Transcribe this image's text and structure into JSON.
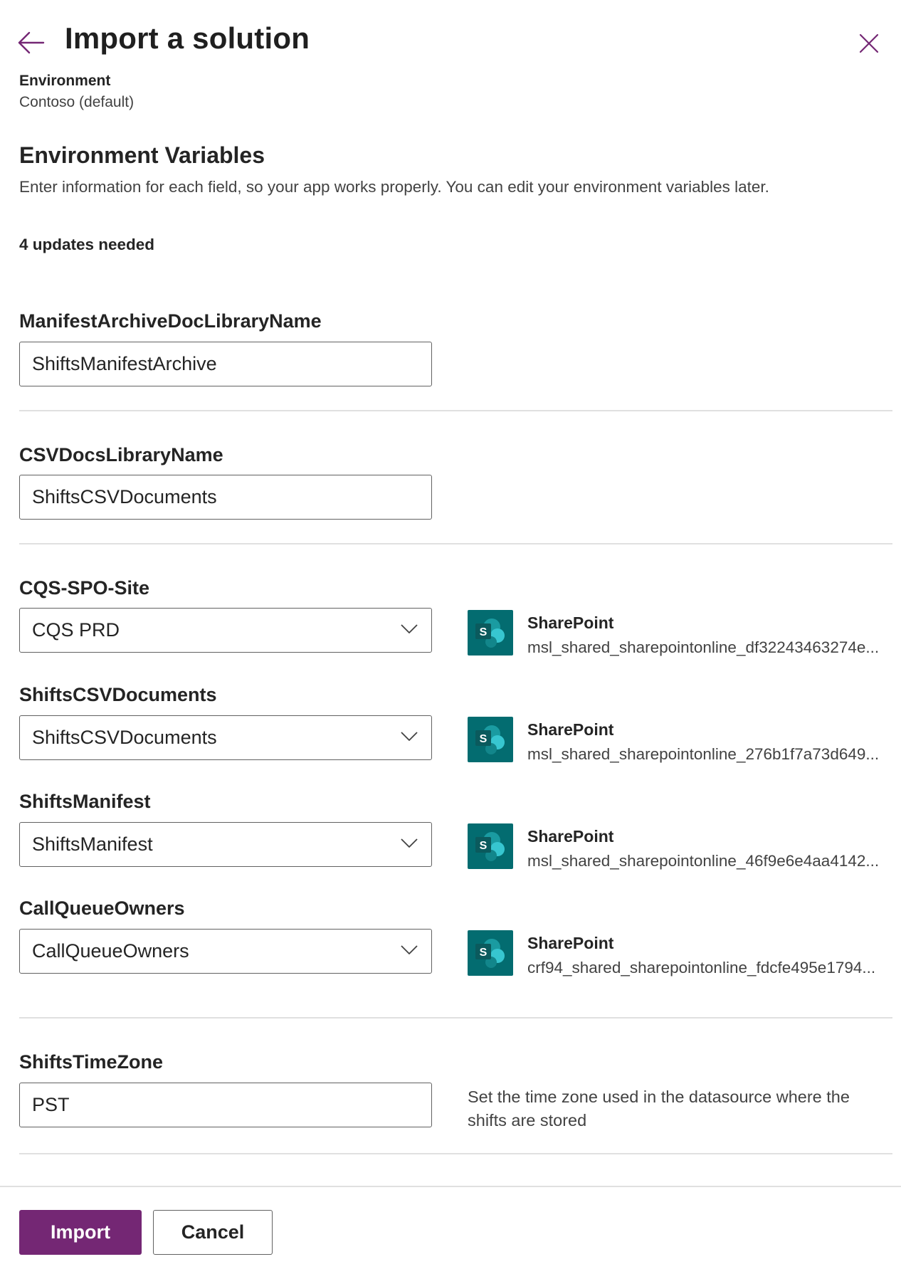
{
  "header": {
    "title": "Import a solution",
    "back_icon": "back-arrow-icon",
    "close_icon": "close-icon"
  },
  "environment": {
    "label": "Environment",
    "value": "Contoso (default)"
  },
  "section": {
    "title": "Environment Variables",
    "description": "Enter information for each field, so your app works properly. You can edit your environment variables later.",
    "updates_needed": "4 updates needed"
  },
  "fields": [
    {
      "label": "ManifestArchiveDocLibraryName",
      "type": "text",
      "value": "ShiftsManifestArchive"
    },
    {
      "label": "CSVDocsLibraryName",
      "type": "text",
      "value": "ShiftsCSVDocuments"
    },
    {
      "label": "CQS-SPO-Site",
      "type": "dropdown",
      "value": "CQS PRD",
      "connection": {
        "name": "SharePoint",
        "id": "msl_shared_sharepointonline_df32243463274e...",
        "icon": "sharepoint-icon"
      }
    },
    {
      "label": "ShiftsCSVDocuments",
      "type": "dropdown",
      "value": "ShiftsCSVDocuments",
      "connection": {
        "name": "SharePoint",
        "id": "msl_shared_sharepointonline_276b1f7a73d649...",
        "icon": "sharepoint-icon"
      }
    },
    {
      "label": "ShiftsManifest",
      "type": "dropdown",
      "value": "ShiftsManifest",
      "connection": {
        "name": "SharePoint",
        "id": "msl_shared_sharepointonline_46f9e6e4aa4142...",
        "icon": "sharepoint-icon"
      }
    },
    {
      "label": "CallQueueOwners",
      "type": "dropdown",
      "value": "CallQueueOwners",
      "connection": {
        "name": "SharePoint",
        "id": "crf94_shared_sharepointonline_fdcfe495e1794...",
        "icon": "sharepoint-icon"
      }
    },
    {
      "label": "ShiftsTimeZone",
      "type": "text",
      "value": "PST",
      "hint": "Set the time zone used in the datasource where the shifts are stored"
    }
  ],
  "footer": {
    "import_label": "Import",
    "cancel_label": "Cancel"
  },
  "colors": {
    "primary": "#742774",
    "sharepoint": "#036c70"
  }
}
